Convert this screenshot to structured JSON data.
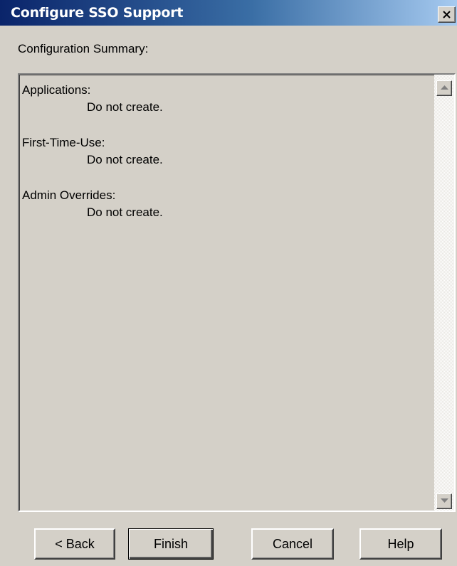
{
  "window": {
    "title": "Configure SSO Support",
    "close_icon": "close-icon"
  },
  "summary": {
    "label": "Configuration Summary:",
    "sections": [
      {
        "heading": "Applications:",
        "value": "Do not create."
      },
      {
        "heading": "First-Time-Use:",
        "value": "Do not create."
      },
      {
        "heading": "Admin Overrides:",
        "value": "Do not create."
      }
    ]
  },
  "scrollbar": {
    "up_icon": "scroll-up-arrow-icon",
    "down_icon": "scroll-down-arrow-icon"
  },
  "buttons": {
    "back": "< Back",
    "finish": "Finish",
    "cancel": "Cancel",
    "help": "Help"
  },
  "colors": {
    "title_bar_start": "#0a246a",
    "title_bar_end": "#a6caf0",
    "face": "#d4d0c8"
  }
}
